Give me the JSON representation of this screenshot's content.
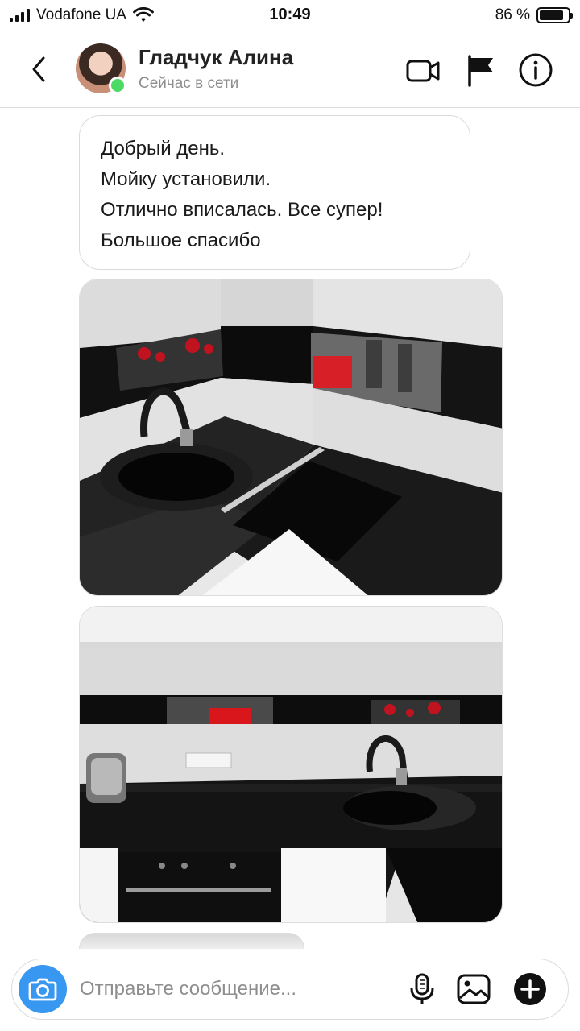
{
  "status_bar": {
    "carrier": "Vodafone UA",
    "time": "10:49",
    "battery_text": "86 %",
    "battery_level": 0.86
  },
  "header": {
    "contact_name": "Гладчук Алина",
    "contact_status": "Сейчас в сети",
    "icons": [
      "back-icon",
      "video-call-icon",
      "flag-icon",
      "info-icon"
    ]
  },
  "messages": {
    "text_lines": [
      "Добрый день.",
      "Мойку установили.",
      "Отлично вписалась.  Все супер!",
      "Большое спасибо"
    ]
  },
  "composer": {
    "placeholder": "Отправьте сообщение...",
    "icons": [
      "camera-icon",
      "microphone-icon",
      "gallery-icon",
      "plus-icon"
    ]
  },
  "colors": {
    "accent": "#3897f0",
    "online": "#4cd964",
    "muted_text": "#8e8e8e",
    "border": "#dbdbdb"
  }
}
